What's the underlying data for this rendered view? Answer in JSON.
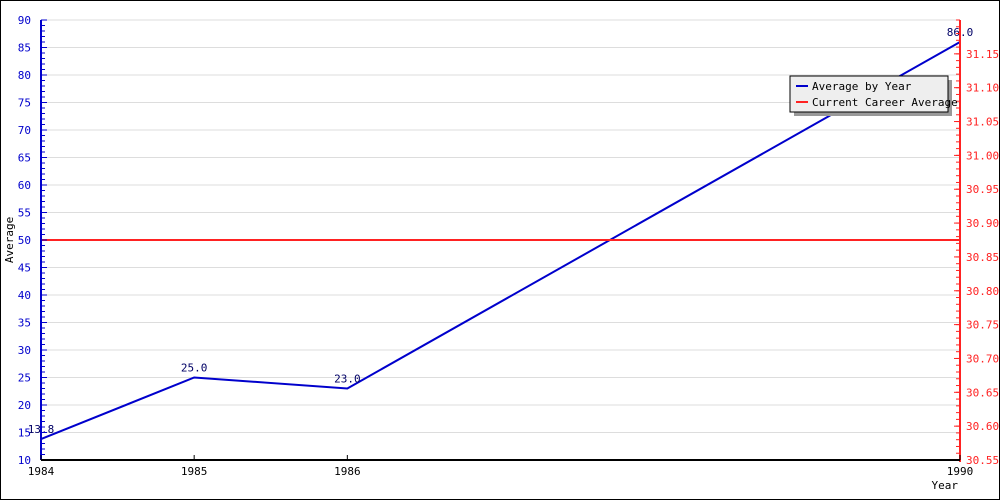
{
  "chart_data": {
    "type": "line",
    "title": "",
    "xlabel": "Year",
    "ylabel": "Average",
    "x": [
      1984,
      1985,
      1986,
      1990
    ],
    "x_tick_labels": [
      "1984",
      "1985",
      "1986",
      "1990"
    ],
    "series": [
      {
        "name": "Average by Year",
        "color": "#0000cc",
        "axis": "left",
        "values": [
          13.8,
          25.0,
          23.0,
          86.0
        ],
        "labels": [
          "13.8",
          "25.0",
          "23.0",
          "86.0"
        ]
      },
      {
        "name": "Current Career Average",
        "color": "#ff2222",
        "axis": "left",
        "values": [
          50,
          50,
          50,
          50
        ]
      }
    ],
    "ylim": [
      10,
      90
    ],
    "y_ticks": [
      10,
      15,
      20,
      25,
      30,
      35,
      40,
      45,
      50,
      55,
      60,
      65,
      70,
      75,
      80,
      85,
      90
    ],
    "y2lim": [
      30.55,
      31.2
    ],
    "y2_ticks": [
      "30.55",
      "30.60",
      "30.65",
      "30.70",
      "30.75",
      "30.80",
      "30.85",
      "30.90",
      "30.95",
      "31.00",
      "31.05",
      "31.10",
      "31.15"
    ],
    "grid": true,
    "legend_position": "top-right",
    "colors": {
      "left_axis": "#0000cc",
      "right_axis": "#ff2222",
      "grid": "#dddddd"
    }
  }
}
